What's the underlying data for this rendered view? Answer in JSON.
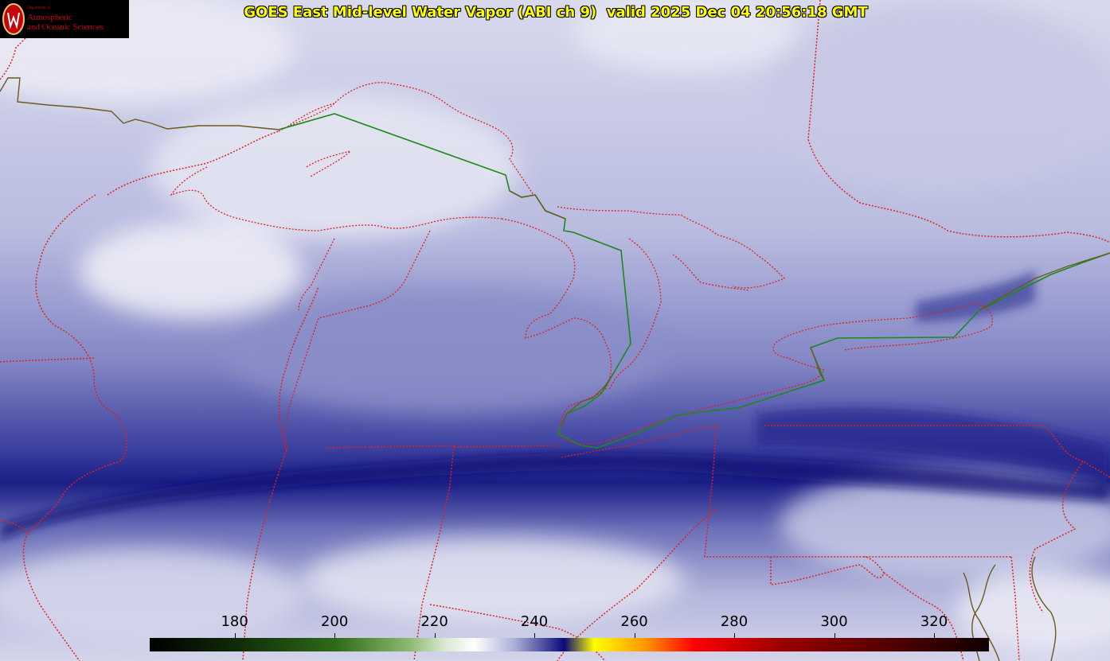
{
  "title": "GOES East Mid-level Water Vapor (ABI ch 9)  valid 2025 Dec 04 20:56:18 GMT",
  "logo": {
    "dept": "Department of",
    "line1": "Atmospheric",
    "line2": "and Oceanic Sciences",
    "seal_letter": "W"
  },
  "colorbar": {
    "min": 163,
    "max": 331,
    "ticks": [
      "180",
      "200",
      "220",
      "240",
      "260",
      "280",
      "300",
      "320"
    ],
    "tick_values": [
      180,
      200,
      220,
      240,
      260,
      280,
      300,
      320
    ],
    "stops": [
      {
        "v": 163,
        "c": "#000000"
      },
      {
        "v": 180,
        "c": "#0f2a08"
      },
      {
        "v": 200,
        "c": "#2e6a16"
      },
      {
        "v": 215,
        "c": "#8cba70"
      },
      {
        "v": 222,
        "c": "#d8e8d0"
      },
      {
        "v": 228,
        "c": "#ffffff"
      },
      {
        "v": 236,
        "c": "#aab0d8"
      },
      {
        "v": 246,
        "c": "#0a0a78"
      },
      {
        "v": 252,
        "c": "#ffff00"
      },
      {
        "v": 262,
        "c": "#ff9900"
      },
      {
        "v": 272,
        "c": "#ff0000"
      },
      {
        "v": 290,
        "c": "#990000"
      },
      {
        "v": 331,
        "c": "#100000"
      }
    ]
  },
  "colors": {
    "state_borders": "#e02020",
    "intl_border": "#1a8a1a",
    "coast": "#6b5a1a",
    "title_text": "#ffff00"
  }
}
